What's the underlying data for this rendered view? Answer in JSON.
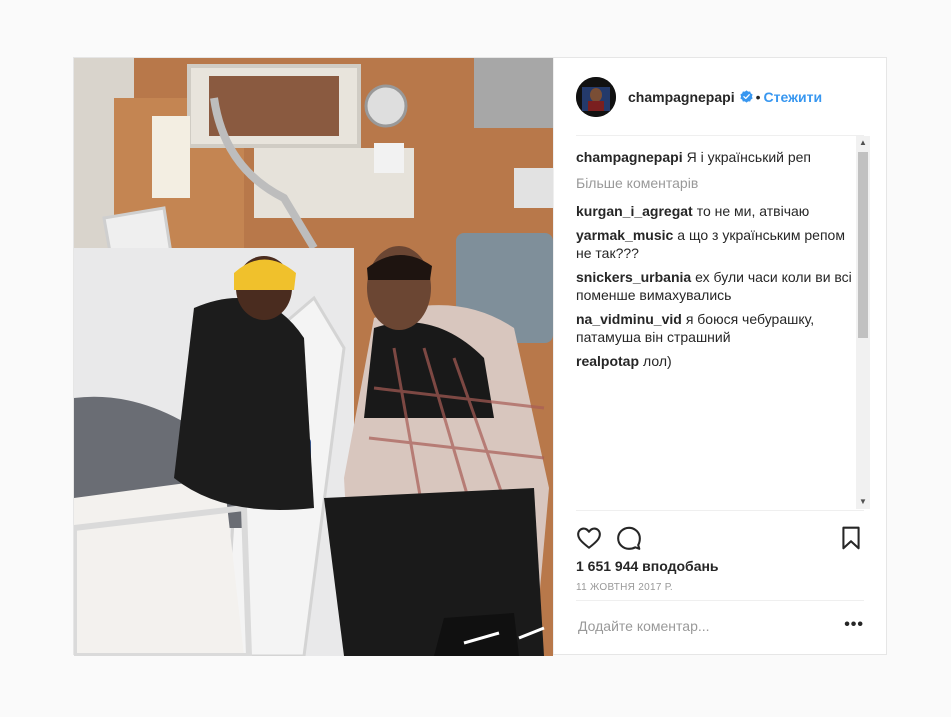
{
  "post": {
    "username": "champagnepapi",
    "separator": "•",
    "follow_label": "Стежити",
    "caption": {
      "user": "champagnepapi",
      "text": "Я і український реп"
    },
    "more_comments_label": "Більше коментарів",
    "comments": [
      {
        "user": "kurgan_i_agregat",
        "text": "то не ми, атвічаю"
      },
      {
        "user": "yarmak_music",
        "text": "а що з українським репом не так???"
      },
      {
        "user": "snickers_urbania",
        "text": "ех були часи коли ви всі поменше вимахувались"
      },
      {
        "user": "na_vidminu_vid",
        "text": "я боюся чебурашку, патамуша він страшний"
      },
      {
        "user": "realpotap",
        "text": "лол)"
      }
    ],
    "likes": "1 651 944 вподобань",
    "date": "11 жовтня 2017 р.",
    "add_comment_placeholder": "Додайте коментар...",
    "options_label": "•••",
    "icons": {
      "like": "heart-icon",
      "comment": "comment-icon",
      "save": "bookmark-icon",
      "verified": "verified-badge-icon"
    },
    "colors": {
      "link": "#3897f0",
      "verified": "#3897f0",
      "text": "#262626",
      "muted": "#999999"
    }
  }
}
